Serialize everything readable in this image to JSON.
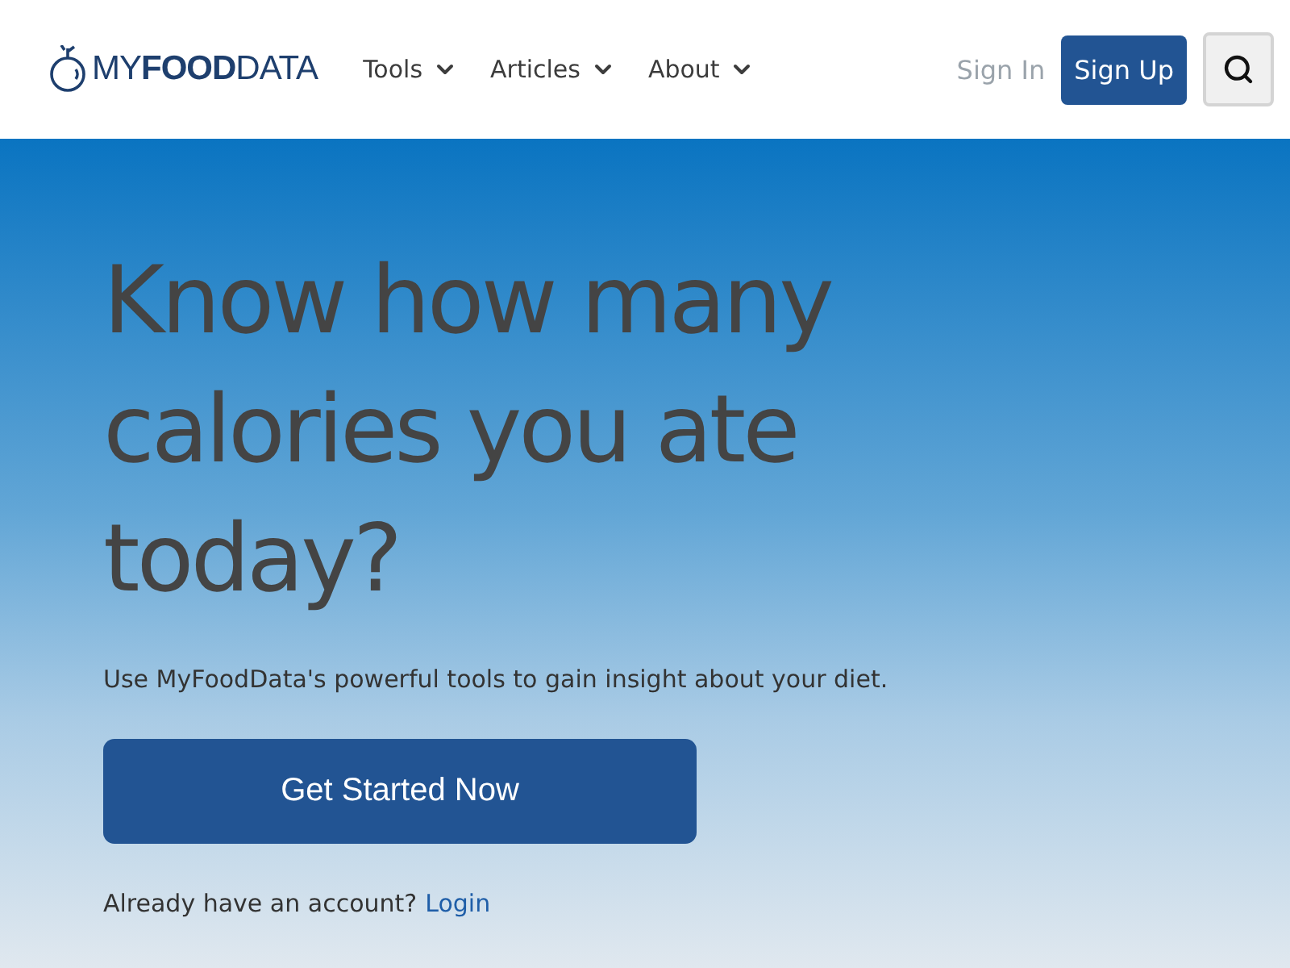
{
  "header": {
    "logo": "MY**FOOD**DATA",
    "nav": [
      {
        "label": "Tools"
      },
      {
        "label": "Articles"
      },
      {
        "label": "About"
      }
    ],
    "sign_in": "Sign In",
    "sign_up": "Sign Up"
  },
  "hero": {
    "title": "Know how many calories you ate today?",
    "subtitle": "Use MyFoodData's powerful tools to gain insight about your diet.",
    "cta": "Get Started Now",
    "account_prompt": "Already have an account?",
    "login": "Login"
  }
}
